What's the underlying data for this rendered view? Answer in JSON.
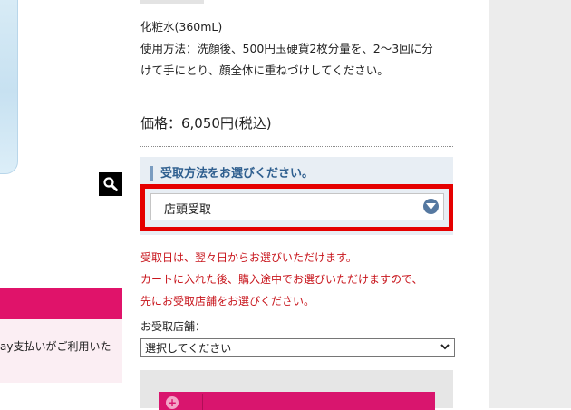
{
  "product": {
    "description_lines": [
      "化粧水(360mL)",
      "使用方法：洗顔後、500円玉硬貨2枚分量を、2～3回に分",
      "けて手にとり、顔全体に重ねづけしてください。"
    ],
    "price": "価格：6,050円(税込)"
  },
  "pickup": {
    "heading": "受取方法をお選びください。",
    "selected_method": "店頭受取"
  },
  "notice_lines": [
    "受取日は、翌々日からお選びいただけます。",
    "カートに入れた後、購入途中でお選びいただけますので、",
    "先にお受取店舗をお選びください。"
  ],
  "store": {
    "label": "お受取店舗：",
    "select_value": "選択してください"
  },
  "left_panel": {
    "payment_text": "ay支払いがご利用いた"
  },
  "colors": {
    "accent_pink": "#e0136a",
    "highlight_red": "#e50000",
    "notice_red": "#c8161d",
    "pickup_blue": "#2f5f8f"
  },
  "icons": [
    "search-icon",
    "chevron-down-icon",
    "plus-icon"
  ]
}
